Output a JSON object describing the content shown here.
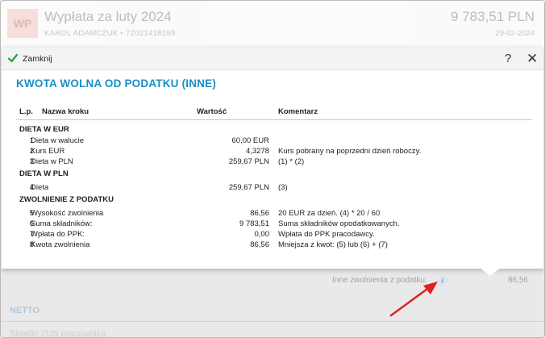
{
  "background": {
    "badge": "WP",
    "title": "Wypłata za luty 2024",
    "subtitle": "KAROL ADAMCZUK  •  72021418199",
    "amount": "9 783,51 PLN",
    "date": "29-02-2024",
    "other_exemptions_label": "Inne zwolnienia z podatku:",
    "other_exemptions_value": "86,56",
    "netto_label": "NETTO",
    "partial_text": "Składki ZUS pracownika"
  },
  "modal": {
    "close_label": "Zamknij",
    "help_label": "?",
    "close_x": "✕",
    "title": "KWOTA WOLNA OD PODATKU (INNE)",
    "columns": {
      "lp": "L.p.",
      "step": "Nazwa kroku",
      "value": "Wartość",
      "comment": "Komentarz"
    },
    "groups": [
      {
        "label": "DIETA W EUR",
        "rows": [
          {
            "lp": "1",
            "step": "Dieta w walucie",
            "value": "60,00 EUR",
            "comment": ""
          },
          {
            "lp": "2",
            "step": "Kurs EUR",
            "value": "4,3278",
            "comment": "Kurs pobrany na poprzedni dzień roboczy."
          },
          {
            "lp": "3",
            "step": "Dieta w PLN",
            "value": "259,67 PLN",
            "comment": "(1) * (2)"
          }
        ]
      },
      {
        "label": "DIETA W PLN",
        "rows": [
          {
            "lp": "4",
            "step": "Dieta",
            "value": "259,67 PLN",
            "comment": "(3)"
          }
        ]
      },
      {
        "label": "ZWOLNIENIE Z PODATKU",
        "rows": [
          {
            "lp": "5",
            "step": "Wysokość zwolnienia",
            "value": "86,56",
            "comment": "20 EUR za dzień. (4) * 20 / 60"
          },
          {
            "lp": "6",
            "step": "Suma składników:",
            "value": "9 783,51",
            "comment": "Suma składników opodatkowanych."
          },
          {
            "lp": "7",
            "step": "Wpłata do PPK:",
            "value": "0,00",
            "comment": "Wpłata do PPK pracodawcy."
          },
          {
            "lp": "8",
            "step": "Kwota zwolnienia",
            "value": "86,56",
            "comment": "Mniejsza z kwot: (5) lub (6) + (7)"
          }
        ]
      }
    ]
  },
  "icons": {
    "check": "check-icon",
    "info": "info-icon",
    "help": "help-icon",
    "close": "close-icon",
    "arrow": "arrow-icon"
  },
  "colors": {
    "accent": "#1a8ec7",
    "check": "#2e9e3a",
    "arrow": "#e02020"
  }
}
